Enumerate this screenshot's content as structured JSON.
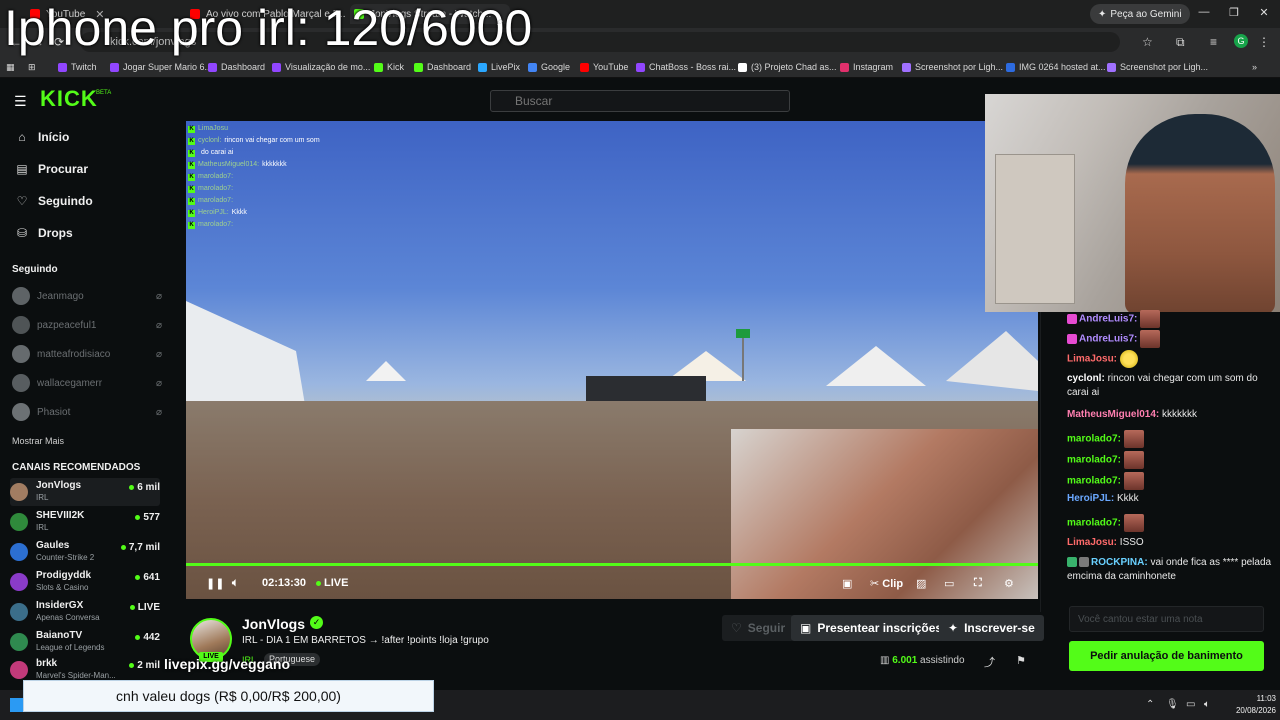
{
  "overlay_title": "Iphone pro irl: 120/6000",
  "browser": {
    "tabs": [
      {
        "title": "YouTube",
        "color": "#ff0000"
      },
      {
        "title": "Ao vivo com Pablo Marçal e D...",
        "color": "#ff0000"
      },
      {
        "title": "JonVlogs Stream - Watch...",
        "color": "#53fc18"
      }
    ],
    "gemini_label": "Peça ao Gemini",
    "address": "kick.com/jonvlogs",
    "profile_initial": "G",
    "bookmarks": [
      {
        "label": "Twitch",
        "color": "#9146ff"
      },
      {
        "label": "Jogar Super Mario 6...",
        "color": "#9146ff"
      },
      {
        "label": "Dashboard",
        "color": "#9146ff"
      },
      {
        "label": "Visualização de mo...",
        "color": "#9146ff"
      },
      {
        "label": "Kick",
        "color": "#53fc18"
      },
      {
        "label": "Dashboard",
        "color": "#53fc18"
      },
      {
        "label": "LivePix",
        "color": "#2aa7ff"
      },
      {
        "label": "Google",
        "color": "#4285f4"
      },
      {
        "label": "YouTube",
        "color": "#ff0000"
      },
      {
        "label": "ChatBoss - Boss rai...",
        "color": "#9146ff"
      },
      {
        "label": "(3) Projeto Chad as...",
        "color": "#ffffff"
      },
      {
        "label": "Instagram",
        "color": "#e1306c"
      },
      {
        "label": "Screenshot por Ligh...",
        "color": "#a070ff"
      },
      {
        "label": "IMG 0264 hosted at...",
        "color": "#2d6be0"
      },
      {
        "label": "Screenshot por Ligh...",
        "color": "#a070ff"
      }
    ]
  },
  "kick": {
    "logo": "KICK",
    "beta": "BETA",
    "search_placeholder": "Buscar"
  },
  "sidebar": {
    "nav": [
      {
        "label": "Início",
        "icon": "home-icon"
      },
      {
        "label": "Procurar",
        "icon": "browse-icon"
      },
      {
        "label": "Seguindo",
        "icon": "heart-icon"
      },
      {
        "label": "Drops",
        "icon": "drops-icon"
      }
    ],
    "following_title": "Seguindo",
    "following": [
      "Jeanmago",
      "pazpeaceful1",
      "matteafrodisiaco",
      "wallacegamerr",
      "Phasiot"
    ],
    "show_more": "Mostrar Mais",
    "recommended_title": "CANAIS RECOMENDADOS",
    "recommended": [
      {
        "name": "JonVlogs",
        "category": "IRL",
        "viewers": "6 mil"
      },
      {
        "name": "SHEVIII2K",
        "category": "IRL",
        "viewers": "577"
      },
      {
        "name": "Gaules",
        "category": "Counter-Strike 2",
        "viewers": "7,7 mil"
      },
      {
        "name": "Prodigyddk",
        "category": "Slots & Casino",
        "viewers": "641"
      },
      {
        "name": "InsiderGX",
        "category": "Apenas Conversa",
        "viewers": "LIVE"
      },
      {
        "name": "BaianoTV",
        "category": "League of Legends",
        "viewers": "442"
      },
      {
        "name": "brkk",
        "category": "Marvel's Spider-Man...",
        "viewers": "2 mil"
      }
    ]
  },
  "player": {
    "time": "02:13:30",
    "live": "LIVE",
    "clip": "Clip",
    "video_chat": [
      {
        "user": "LimaJosu",
        "text": ""
      },
      {
        "user": "cyclonl:",
        "text": "rincon vai chegar com um som"
      },
      {
        "user": "",
        "text": "do carai ai"
      },
      {
        "user": "MatheusMiguel014:",
        "text": "kkkkkkk"
      },
      {
        "user": "marolado7:",
        "text": ""
      },
      {
        "user": "marolado7:",
        "text": ""
      },
      {
        "user": "marolado7:",
        "text": ""
      },
      {
        "user": "HeroiPJL:",
        "text": "Kkkk"
      },
      {
        "user": "marolado7:",
        "text": ""
      }
    ]
  },
  "stream": {
    "name": "JonVlogs",
    "title": "IRL - DIA 1 EM BARRETOS → !after !points !loja !grupo",
    "category": "IRL",
    "language": "Portuguese",
    "live_badge": "LIVE",
    "follow_label": "Seguir",
    "gift_label": "Presentear inscrições",
    "subscribe_label": "Inscrever-se",
    "viewers": "6.001",
    "viewers_suffix": "assistindo"
  },
  "chat": {
    "messages": [
      {
        "user": "AndreLuis7:",
        "text": "",
        "color": "#b18cff",
        "emote": true
      },
      {
        "user": "AndreLuis7:",
        "text": "",
        "color": "#b18cff",
        "emote": true
      },
      {
        "user": "LimaJosu:",
        "text": "",
        "color": "#ff6b6b",
        "emote_yellow": true
      },
      {
        "user": "cyclonl:",
        "text": "rincon vai chegar com um som do carai ai",
        "color": "#ffffff"
      },
      {
        "user": "MatheusMiguel014:",
        "text": "kkkkkkk",
        "color": "#ff7fb0"
      },
      {
        "user": "marolado7:",
        "text": "",
        "color": "#53fc18",
        "emote": true
      },
      {
        "user": "marolado7:",
        "text": "",
        "color": "#53fc18",
        "emote": true
      },
      {
        "user": "marolado7:",
        "text": "",
        "color": "#53fc18",
        "emote": true
      },
      {
        "user": "HeroiPJL:",
        "text": "Kkkk",
        "color": "#6aa8ff"
      },
      {
        "user": "marolado7:",
        "text": "",
        "color": "#53fc18",
        "emote": true
      },
      {
        "user": "LimaJosu:",
        "text": "ISSO",
        "color": "#ff6b6b"
      },
      {
        "user": "ROCKPINA:",
        "text": "vai onde fica as **** pelada emcima da caminhonete",
        "color": "#6ad1ff"
      }
    ],
    "input_placeholder": "Você cantou estar uma nota",
    "unban_label": "Pedir anulação de banimento"
  },
  "overlays": {
    "livepix": "livepix.gg/veggano",
    "donation": "cnh valeu dogs (R$ 0,00/R$ 200,00)"
  },
  "taskbar": {
    "time": "11:03",
    "date": "20/08/2026"
  }
}
